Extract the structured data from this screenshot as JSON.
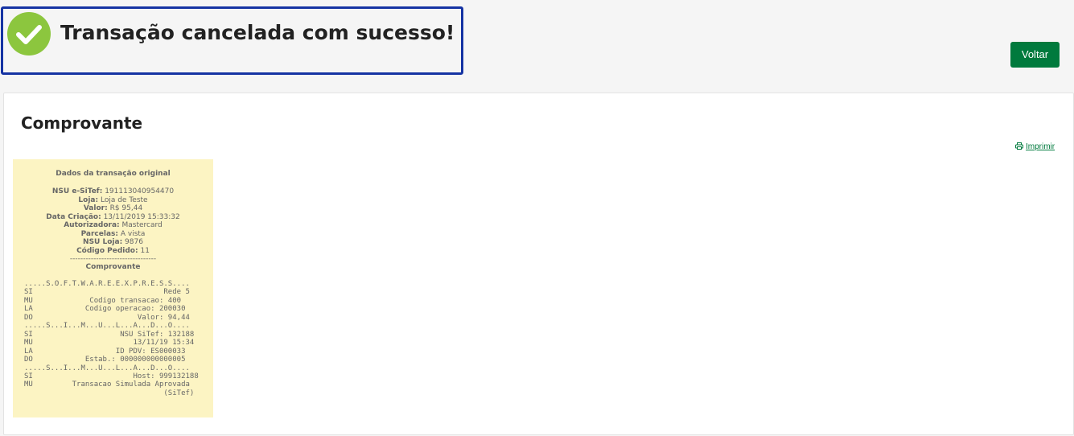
{
  "header": {
    "success_message": "Transação cancelada com sucesso!",
    "back_button": "Voltar"
  },
  "panel": {
    "title": "Comprovante",
    "print_link": "Imprimir"
  },
  "receipt": {
    "header": "Dados da transação original",
    "fields": [
      {
        "label": "NSU e-SiTef:",
        "value": "191113040954470"
      },
      {
        "label": "Loja:",
        "value": "Loja de Teste"
      },
      {
        "label": "Valor:",
        "value": "R$ 95,44"
      },
      {
        "label": "Data Criação:",
        "value": "13/11/2019 15:33:32"
      },
      {
        "label": "Autorizadora:",
        "value": "Mastercard"
      },
      {
        "label": "Parcelas:",
        "value": "A vista"
      },
      {
        "label": "NSU Loja:",
        "value": "9876"
      },
      {
        "label": "Código Pedido:",
        "value": "11"
      }
    ],
    "separator": "---------------------------------",
    "receipt_title": "Comprovante",
    "receipt_lines": [
      ".....S.O.F.T.W.A.R.E.E.X.P.R.E.S.S....",
      "SI                              Rede 5",
      "MU             Codigo transacao: 400",
      "LA            Codigo operacao: 200030",
      "DO                        Valor: 94,44",
      ".....S...I...M...U...L...A...D...O....",
      "SI                    NSU SiTef: 132188",
      "MU                       13/11/19 15:34",
      "LA                   ID PDV: ES000033",
      "DO            Estab.: 000000000000005",
      ".....S...I...M...U...L...A...D...O....",
      "SI                       Host: 999132188",
      "MU         Transacao Simulada Aprovada",
      "                                (SiTef)"
    ]
  },
  "colors": {
    "accent_green": "#007a3d",
    "success_icon": "#8cc63e",
    "highlight_border": "#1533a3",
    "receipt_background": "#fcf4c3"
  },
  "icons": {
    "success": "check-circle-icon",
    "print": "printer-icon"
  }
}
